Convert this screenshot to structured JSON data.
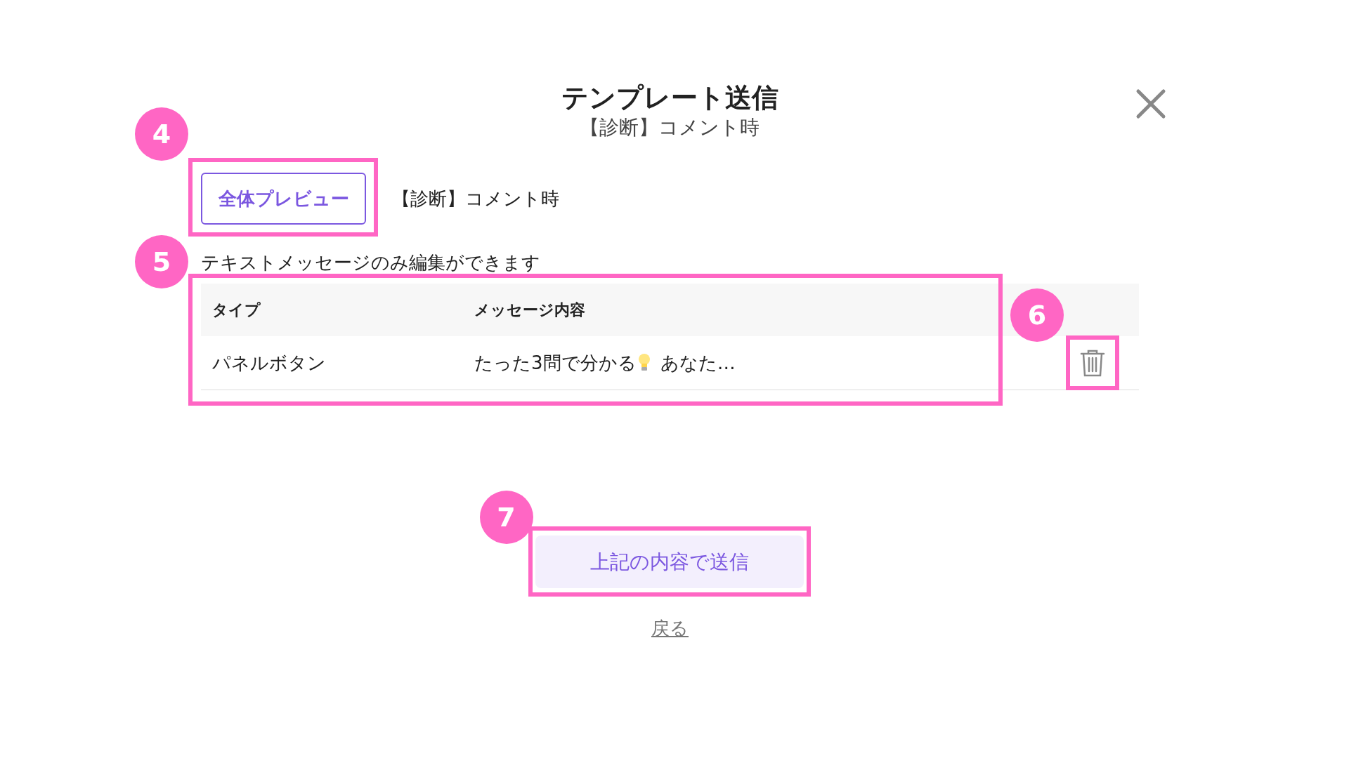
{
  "dialog": {
    "title": "テンプレート送信",
    "subtitle": "【診断】コメント時"
  },
  "preview_button": {
    "label": "全体プレビュー",
    "callout": "4"
  },
  "template_name": "【診断】コメント時",
  "note": "テキストメッセージのみ編集ができます",
  "table": {
    "callout": "5",
    "columns": [
      "タイプ",
      "メッセージ内容"
    ],
    "rows": [
      {
        "type": "パネルボタン",
        "message_parts": [
          {
            "kind": "text",
            "text": "たった3問で分かる"
          },
          {
            "kind": "bulb"
          },
          {
            "kind": "text",
            "text": " あなた…"
          }
        ],
        "delete_callout": "6"
      }
    ]
  },
  "send_button": {
    "label": "上記の内容で送信",
    "callout": "7"
  },
  "back_link": "戻る"
}
